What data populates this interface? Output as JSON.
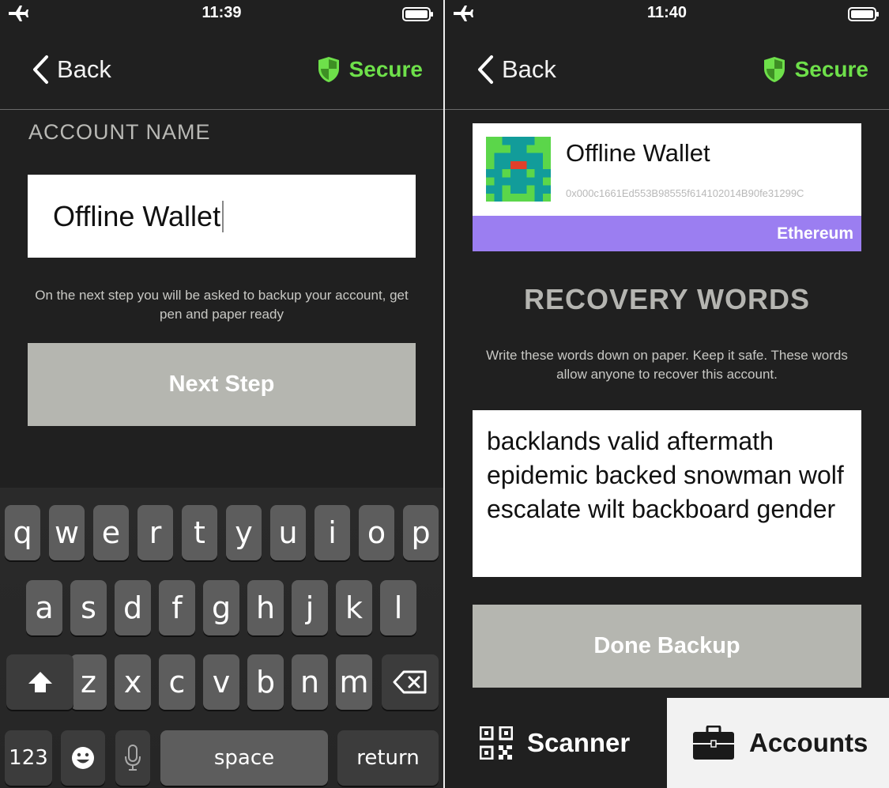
{
  "left": {
    "status": {
      "time": "11:39"
    },
    "nav": {
      "back_label": "Back",
      "secure_label": "Secure"
    },
    "account_name_label": "ACCOUNT NAME",
    "account_name_value": "Offline Wallet",
    "hint": "On the next step you will be asked to backup your account, get pen and paper ready",
    "next_button": "Next Step",
    "keyboard": {
      "row1": [
        "q",
        "w",
        "e",
        "r",
        "t",
        "y",
        "u",
        "i",
        "o",
        "p"
      ],
      "row2": [
        "a",
        "s",
        "d",
        "f",
        "g",
        "h",
        "j",
        "k",
        "l"
      ],
      "row3": [
        "z",
        "x",
        "c",
        "v",
        "b",
        "n",
        "m"
      ],
      "numbers_key": "123",
      "space_key": "space",
      "return_key": "return"
    }
  },
  "right": {
    "status": {
      "time": "11:40"
    },
    "nav": {
      "back_label": "Back",
      "secure_label": "Secure"
    },
    "card": {
      "wallet_name": "Offline Wallet",
      "address": "0x000c1661Ed553B98555f614102014B90fe31299C",
      "network": "Ethereum",
      "network_color": "#9b7ef1"
    },
    "recovery_title": "RECOVERY WORDS",
    "recovery_hint": "Write these words down on paper. Keep it safe. These words allow anyone to recover this account.",
    "recovery_words": "backlands valid aftermath epidemic backed snowman wolf escalate wilt backboard gender",
    "done_button": "Done Backup",
    "tabs": {
      "scanner": "Scanner",
      "accounts": "Accounts"
    }
  },
  "colors": {
    "secure_green": "#6ee04a",
    "button_gray": "#b5b6b0",
    "background": "#202020"
  },
  "icons": [
    "airplane-icon",
    "battery-icon",
    "back-chevron-icon",
    "shield-icon",
    "microphone-icon",
    "emoji-icon",
    "shift-icon",
    "delete-icon",
    "qr-code-icon",
    "briefcase-icon"
  ]
}
